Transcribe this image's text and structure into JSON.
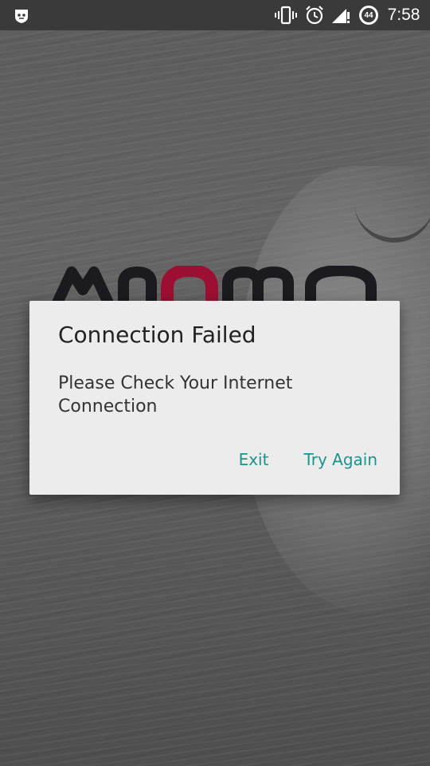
{
  "status_bar": {
    "time": "7:58",
    "battery_level": "44",
    "icons": [
      "app-notification-icon",
      "vibrate-icon",
      "alarm-icon",
      "signal-no-data-icon",
      "battery-icon"
    ]
  },
  "background_app": {
    "logo_name": "app-logo",
    "accent_color": "#c8163c"
  },
  "dialog": {
    "title": "Connection Failed",
    "message": "Please Check Your Internet Connection",
    "buttons": {
      "exit": "Exit",
      "try_again": "Try Again"
    },
    "button_color": "#17968e"
  }
}
